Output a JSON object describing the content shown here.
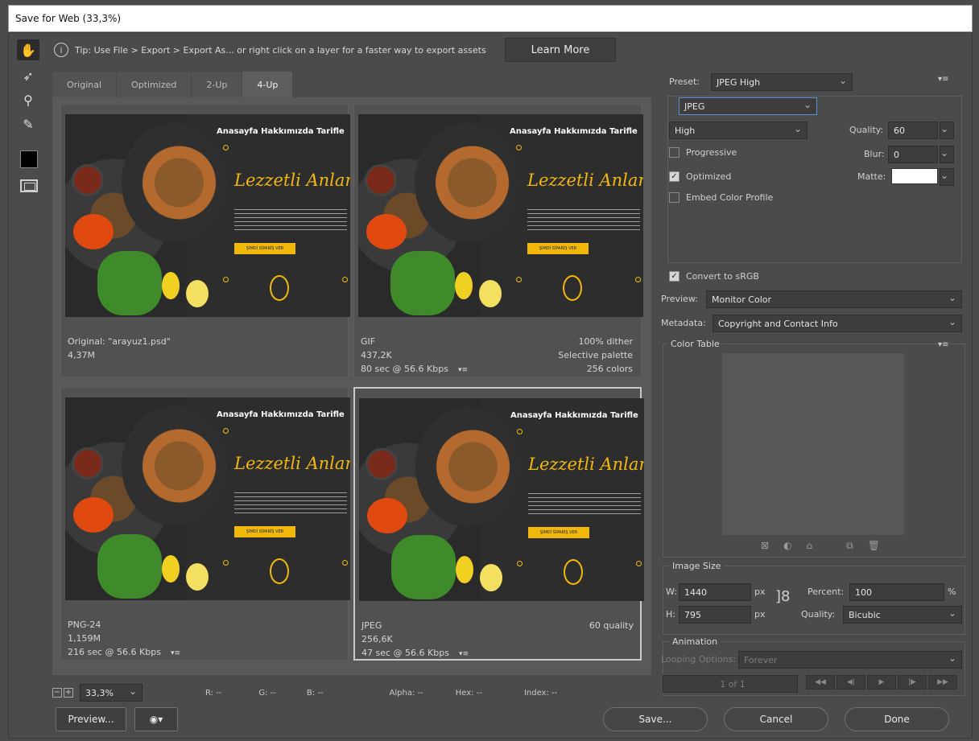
{
  "window": {
    "title": "Save for Web (33,3%)"
  },
  "tip": {
    "icon": "info-icon",
    "text": "Tip: Use File > Export > Export As... or right click on a layer for a faster way to export assets",
    "learn_more": "Learn More"
  },
  "tools": [
    "hand-icon",
    "slice-select-icon",
    "zoom-icon",
    "eyedropper-icon"
  ],
  "tabs": [
    "Original",
    "Optimized",
    "2-Up",
    "4-Up"
  ],
  "artwork": {
    "nav": "Anasayfa   Hakkımızda   Tarifle",
    "script_title": "Lezzetli Anlar",
    "cta": "ŞİMDİ SİPARİŞ VER"
  },
  "panes": [
    {
      "line1": "Original: \"arayuz1.psd\"",
      "line2": "4,37M",
      "line3": "",
      "right1": "",
      "right2": "",
      "right3": ""
    },
    {
      "line1": "GIF",
      "line2": "437,2K",
      "line3": "80 sec @ 56.6 Kbps",
      "right1": "100% dither",
      "right2": "Selective palette",
      "right3": "256 colors"
    },
    {
      "line1": "PNG-24",
      "line2": "1,159M",
      "line3": "216 sec @ 56.6 Kbps",
      "right1": "",
      "right2": "",
      "right3": ""
    },
    {
      "line1": "JPEG",
      "line2": "256,6K",
      "line3": "47 sec @ 56.6 Kbps",
      "right1": "60 quality",
      "right2": "",
      "right3": ""
    }
  ],
  "status": {
    "zoom": "33,3%",
    "r": "R: --",
    "g": "G: --",
    "b": "B: --",
    "alpha": "Alpha: --",
    "hex": "Hex: --",
    "index": "Index: --"
  },
  "buttons": {
    "preview": "Preview...",
    "save": "Save...",
    "cancel": "Cancel",
    "done": "Done"
  },
  "settings": {
    "preset_label": "Preset:",
    "preset_value": "JPEG High",
    "format": "JPEG",
    "quality_level": "High",
    "quality_label": "Quality:",
    "quality_value": "60",
    "blur_label": "Blur:",
    "blur_value": "0",
    "matte_label": "Matte:",
    "progressive": "Progressive",
    "optimized": "Optimized",
    "embed_profile": "Embed Color Profile",
    "convert_srgb": "Convert to sRGB",
    "preview_label": "Preview:",
    "preview_value": "Monitor Color",
    "metadata_label": "Metadata:",
    "metadata_value": "Copyright and Contact Info"
  },
  "color_table": {
    "title": "Color Table"
  },
  "image_size": {
    "title": "Image Size",
    "w_label": "W:",
    "w_value": "1440",
    "h_label": "H:",
    "h_value": "795",
    "unit": "px",
    "percent_label": "Percent:",
    "percent_value": "100",
    "percent_unit": "%",
    "quality_label": "Quality:",
    "quality_value": "Bicubic"
  },
  "animation": {
    "title": "Animation",
    "looping_label": "Looping Options:",
    "looping_value": "Forever",
    "frame": "1 of 1"
  }
}
